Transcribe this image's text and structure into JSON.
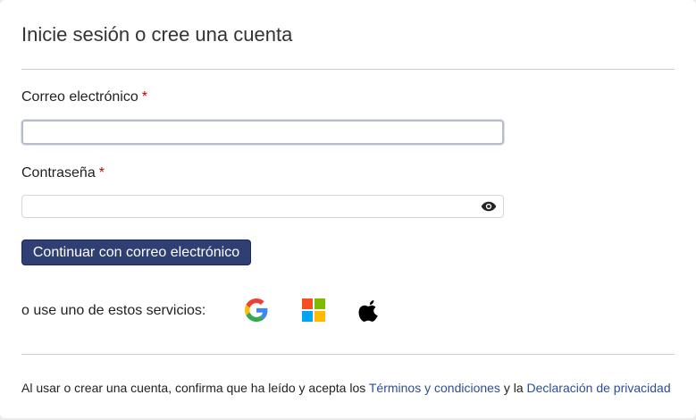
{
  "header": {
    "title": "Inicie sesión o cree una cuenta"
  },
  "form": {
    "email": {
      "label": "Correo electrónico",
      "required_mark": "*",
      "value": "",
      "placeholder": ""
    },
    "password": {
      "label": "Contraseña",
      "required_mark": "*",
      "value": "",
      "placeholder": "",
      "toggle_icon": "eye-icon"
    },
    "continue_button_label": "Continuar con correo electrónico"
  },
  "alternatives": {
    "label": "o use uno de estos servicios:",
    "services": [
      "google-icon",
      "microsoft-icon",
      "apple-icon"
    ]
  },
  "footer": {
    "text_before": "Al usar o crear una cuenta, confirma que ha leído y acepta los ",
    "terms_link": "Términos y condiciones",
    "text_middle": " y la ",
    "privacy_link": "Declaración de privacidad"
  },
  "colors": {
    "primary_button": "#2f3f74",
    "link": "#2c4f91",
    "required": "#c00000"
  }
}
